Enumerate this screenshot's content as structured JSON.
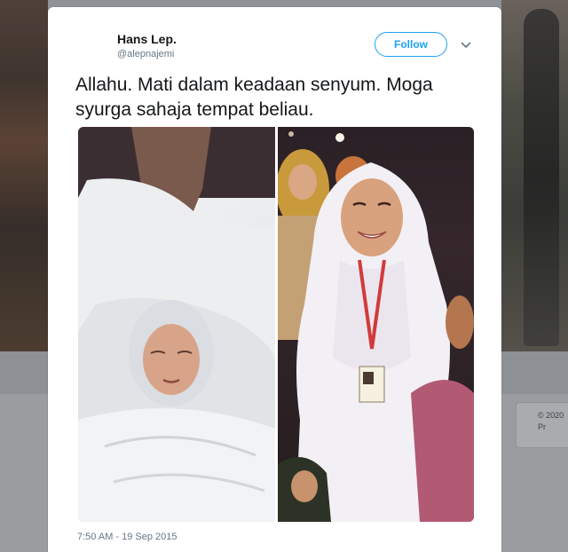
{
  "tweet": {
    "author_name": "Hans Lep.",
    "author_handle": "@alepnajemi",
    "follow_label": "Follow",
    "text": "Allahu. Mati dalam keadaan senyum. Moga syurga sahaja tempat beliau.",
    "timestamp": "7:50 AM - 19 Sep 2015"
  },
  "background": {
    "footer_line1": "© 2020",
    "footer_line2": "Pr"
  },
  "colors": {
    "accent": "#1da1f2",
    "text_primary": "#14171a",
    "text_secondary": "#657786"
  },
  "icons": {
    "more": "chevron-down-icon"
  }
}
